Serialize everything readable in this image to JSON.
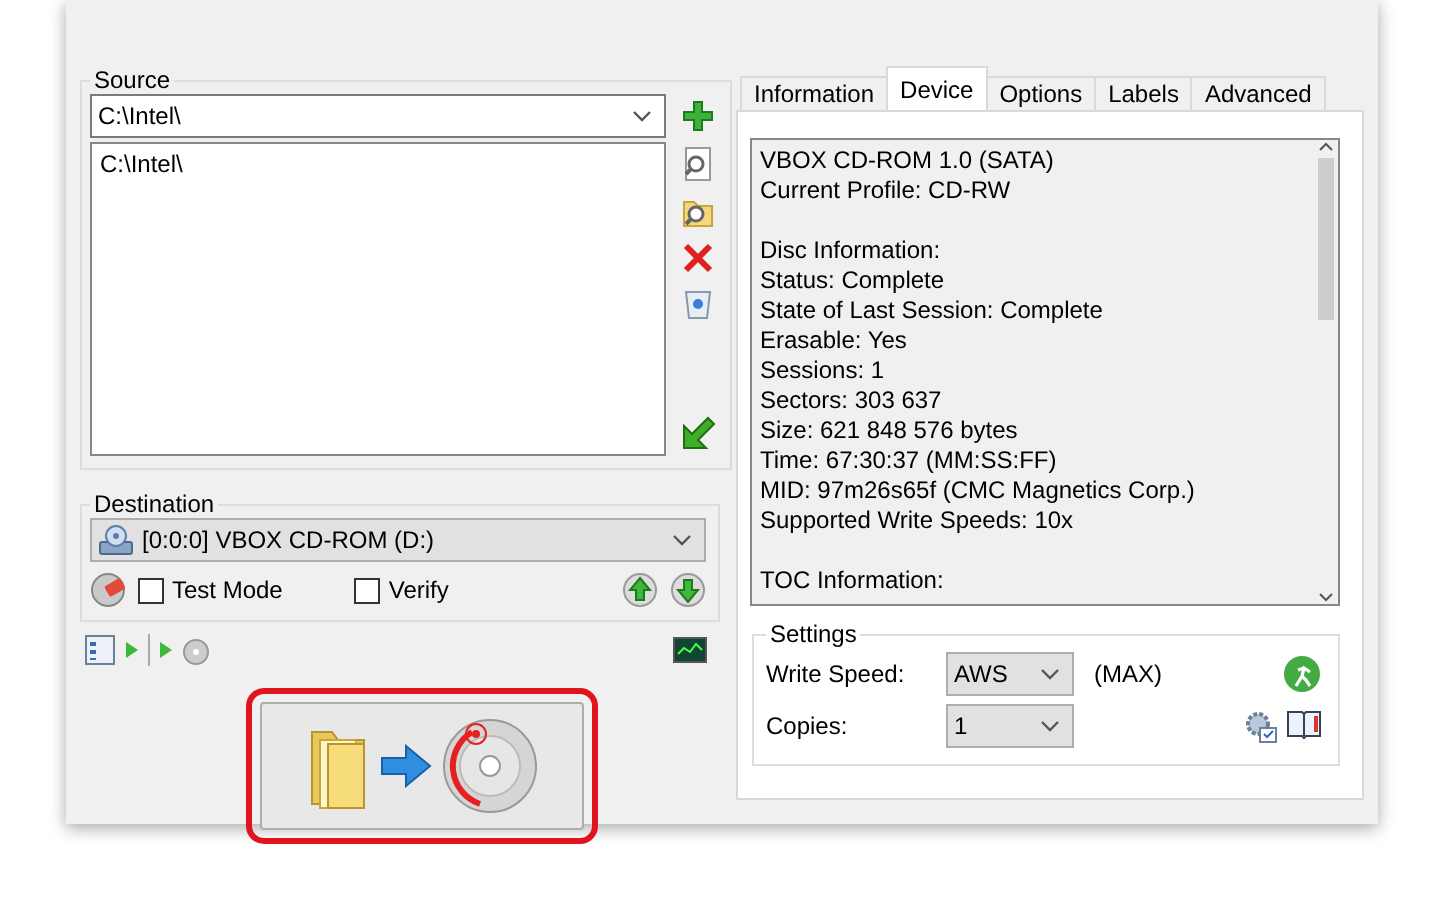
{
  "source": {
    "label": "Source",
    "path": "C:\\Intel\\",
    "items": [
      "C:\\Intel\\"
    ]
  },
  "destination": {
    "label": "Destination",
    "device": "[0:0:0] VBOX CD-ROM (D:)",
    "options": [
      {
        "label": "Test Mode",
        "checked": false
      },
      {
        "label": "Verify",
        "checked": false
      }
    ]
  },
  "tabs": [
    {
      "label": "Information",
      "selected": false
    },
    {
      "label": "Device",
      "selected": true
    },
    {
      "label": "Options",
      "selected": false
    },
    {
      "label": "Labels",
      "selected": false
    },
    {
      "label": "Advanced",
      "selected": false
    }
  ],
  "device_info": [
    [
      "VBOX CD-ROM 1.0 (SATA)",
      "Current Profile: CD-RW"
    ],
    [
      "Disc Information:",
      "Status: Complete",
      "State of Last Session: Complete",
      "Erasable: Yes",
      "Sessions: 1",
      "Sectors: 303 637",
      "Size: 621 848 576 bytes",
      "Time: 67:30:37 (MM:SS:FF)",
      "MID: 97m26s65f (CMC Magnetics Corp.)",
      "Supported Write Speeds: 10x"
    ],
    [
      "TOC Information:"
    ]
  ],
  "settings": {
    "label": "Settings",
    "write_speed": {
      "label": "Write Speed:",
      "value": "AWS",
      "note": "(MAX)"
    },
    "copies": {
      "label": "Copies:",
      "value": "1"
    }
  }
}
